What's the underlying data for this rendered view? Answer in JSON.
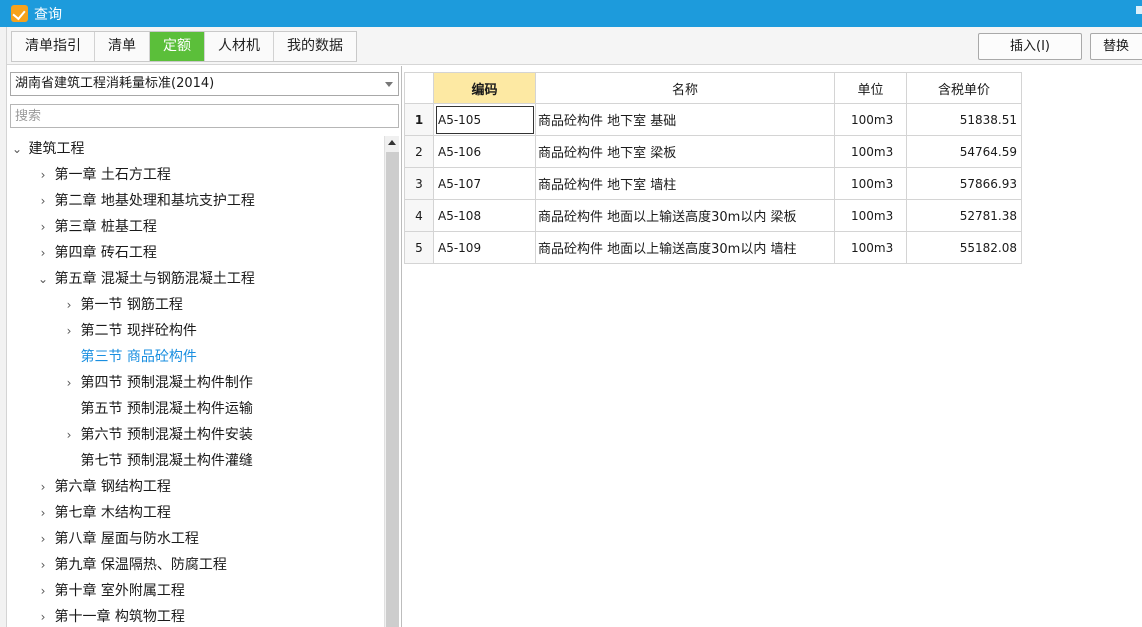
{
  "window": {
    "title": "查询"
  },
  "toolbar": {
    "tabs": [
      {
        "label": "清单指引",
        "active": false
      },
      {
        "label": "清单",
        "active": false
      },
      {
        "label": "定额",
        "active": true
      },
      {
        "label": "人材机",
        "active": false
      },
      {
        "label": "我的数据",
        "active": false
      }
    ],
    "insert_label": "插入(I)",
    "replace_label": "替换"
  },
  "left": {
    "standard": "湖南省建筑工程消耗量标准(2014)",
    "search_placeholder": "搜索",
    "tree": [
      {
        "label": "建筑工程",
        "level": 0,
        "state": "expanded"
      },
      {
        "label": "第一章 土石方工程",
        "level": 1,
        "state": "collapsed"
      },
      {
        "label": "第二章 地基处理和基坑支护工程",
        "level": 1,
        "state": "collapsed"
      },
      {
        "label": "第三章 桩基工程",
        "level": 1,
        "state": "collapsed"
      },
      {
        "label": "第四章 砖石工程",
        "level": 1,
        "state": "collapsed"
      },
      {
        "label": "第五章 混凝土与钢筋混凝土工程",
        "level": 1,
        "state": "expanded"
      },
      {
        "label": "第一节 钢筋工程",
        "level": 2,
        "state": "collapsed"
      },
      {
        "label": "第二节 现拌砼构件",
        "level": 2,
        "state": "collapsed"
      },
      {
        "label": "第三节 商品砼构件",
        "level": 2,
        "state": "leaf",
        "selected": true
      },
      {
        "label": "第四节 预制混凝土构件制作",
        "level": 2,
        "state": "collapsed"
      },
      {
        "label": "第五节 预制混凝土构件运输",
        "level": 2,
        "state": "leaf"
      },
      {
        "label": "第六节 预制混凝土构件安装",
        "level": 2,
        "state": "collapsed"
      },
      {
        "label": "第七节 预制混凝土构件灌缝",
        "level": 2,
        "state": "leaf"
      },
      {
        "label": "第六章 钢结构工程",
        "level": 1,
        "state": "collapsed"
      },
      {
        "label": "第七章 木结构工程",
        "level": 1,
        "state": "collapsed"
      },
      {
        "label": "第八章 屋面与防水工程",
        "level": 1,
        "state": "collapsed"
      },
      {
        "label": "第九章 保温隔热、防腐工程",
        "level": 1,
        "state": "collapsed"
      },
      {
        "label": "第十章 室外附属工程",
        "level": 1,
        "state": "collapsed"
      },
      {
        "label": "第十一章 构筑物工程",
        "level": 1,
        "state": "collapsed"
      }
    ]
  },
  "grid": {
    "headers": {
      "code": "编码",
      "name": "名称",
      "unit": "单位",
      "price": "含税单价"
    },
    "rows": [
      {
        "idx": "1",
        "code": "A5-105",
        "name": "商品砼构件 地下室 基础",
        "unit": "100m3",
        "price": "51838.51"
      },
      {
        "idx": "2",
        "code": "A5-106",
        "name": "商品砼构件 地下室 梁板",
        "unit": "100m3",
        "price": "54764.59"
      },
      {
        "idx": "3",
        "code": "A5-107",
        "name": "商品砼构件 地下室 墙柱",
        "unit": "100m3",
        "price": "57866.93"
      },
      {
        "idx": "4",
        "code": "A5-108",
        "name": "商品砼构件 地面以上输送高度30m以内 梁板",
        "unit": "100m3",
        "price": "52781.38"
      },
      {
        "idx": "5",
        "code": "A5-109",
        "name": "商品砼构件 地面以上输送高度30m以内 墙柱",
        "unit": "100m3",
        "price": "55182.08"
      }
    ]
  },
  "icons": {
    "app": "app-logo-icon",
    "expanded": "chevron-down-icon",
    "collapsed": "chevron-right-icon"
  },
  "colors": {
    "titlebar": "#1d9bdc",
    "active_tab": "#5bbf3a",
    "selected_node": "#1a8fe0",
    "header_highlight": "#fde9a3"
  }
}
